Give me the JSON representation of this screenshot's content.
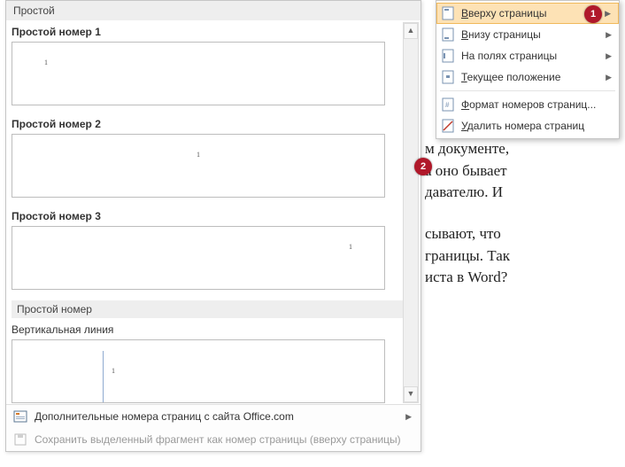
{
  "gallery": {
    "section_simple": "Простой",
    "items": [
      {
        "label": "Простой номер 1",
        "num": "1",
        "pos": "left"
      },
      {
        "label": "Простой номер 2",
        "num": "1",
        "pos": "center"
      },
      {
        "label": "Простой номер 3",
        "num": "1",
        "pos": "right"
      }
    ],
    "section_plain": "Простой номер",
    "item_vline": {
      "label": "Вертикальная линия",
      "num": "1"
    }
  },
  "footer": {
    "more": "Дополнительные номера страниц с сайта Office.com",
    "save": "Сохранить выделенный фрагмент как номер страницы (вверху страницы)"
  },
  "menu": {
    "top": "Вверху страницы",
    "bottom": "Внизу страницы",
    "margins": "На полях страницы",
    "current": "Текущее положение",
    "format": "Формат номеров страниц...",
    "remove": "Удалить номера страниц"
  },
  "doc": {
    "l1": "м документе,",
    "l2": "а оно бывает",
    "l3": "давателю. И",
    "l4": "сывают, что",
    "l5": "границы. Так",
    "l6": "иста в Word?"
  },
  "markers": {
    "one": "1",
    "two": "2"
  }
}
